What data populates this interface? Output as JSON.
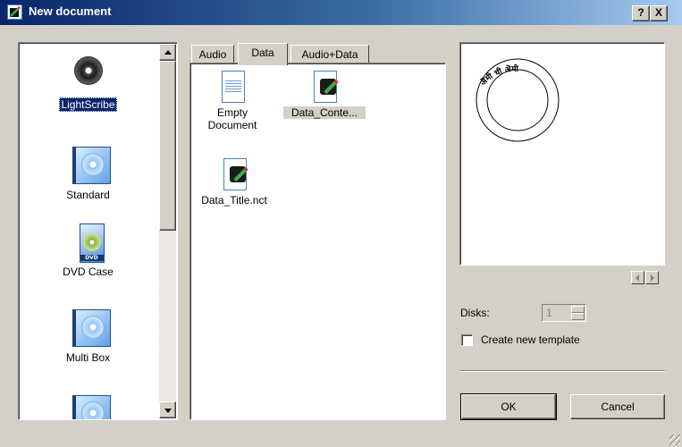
{
  "window": {
    "title": "New document"
  },
  "title_buttons": {
    "help": "?",
    "close": "X"
  },
  "layouts": [
    {
      "label": "LightScribe",
      "icon": "lightscribe-disc-icon",
      "selected": true
    },
    {
      "label": "Standard",
      "icon": "cd-case-icon"
    },
    {
      "label": "DVD Case",
      "icon": "dvd-case-icon",
      "icon_text": "DVD"
    },
    {
      "label": "Multi Box",
      "icon": "multi-box-icon"
    }
  ],
  "tabs": [
    {
      "label": "Audio"
    },
    {
      "label": "Data",
      "active": true
    },
    {
      "label": "Audio+Data"
    }
  ],
  "files": [
    {
      "label_line1": "Empty",
      "label_line2": "Document",
      "icon": "empty-document-icon"
    },
    {
      "label_line1": "Data_Conte...",
      "label_line2": "",
      "icon": "template-file-icon",
      "selected": true
    },
    {
      "label_line1": "Data_Title.nct",
      "label_line2": "",
      "icon": "template-file-icon"
    }
  ],
  "preview": {
    "disc_text": "ऄमी ची ऄमी"
  },
  "disks": {
    "label": "Disks:",
    "value": "1"
  },
  "create_template": {
    "label": "Create new template",
    "checked": false
  },
  "buttons": {
    "ok": "OK",
    "cancel": "Cancel"
  }
}
